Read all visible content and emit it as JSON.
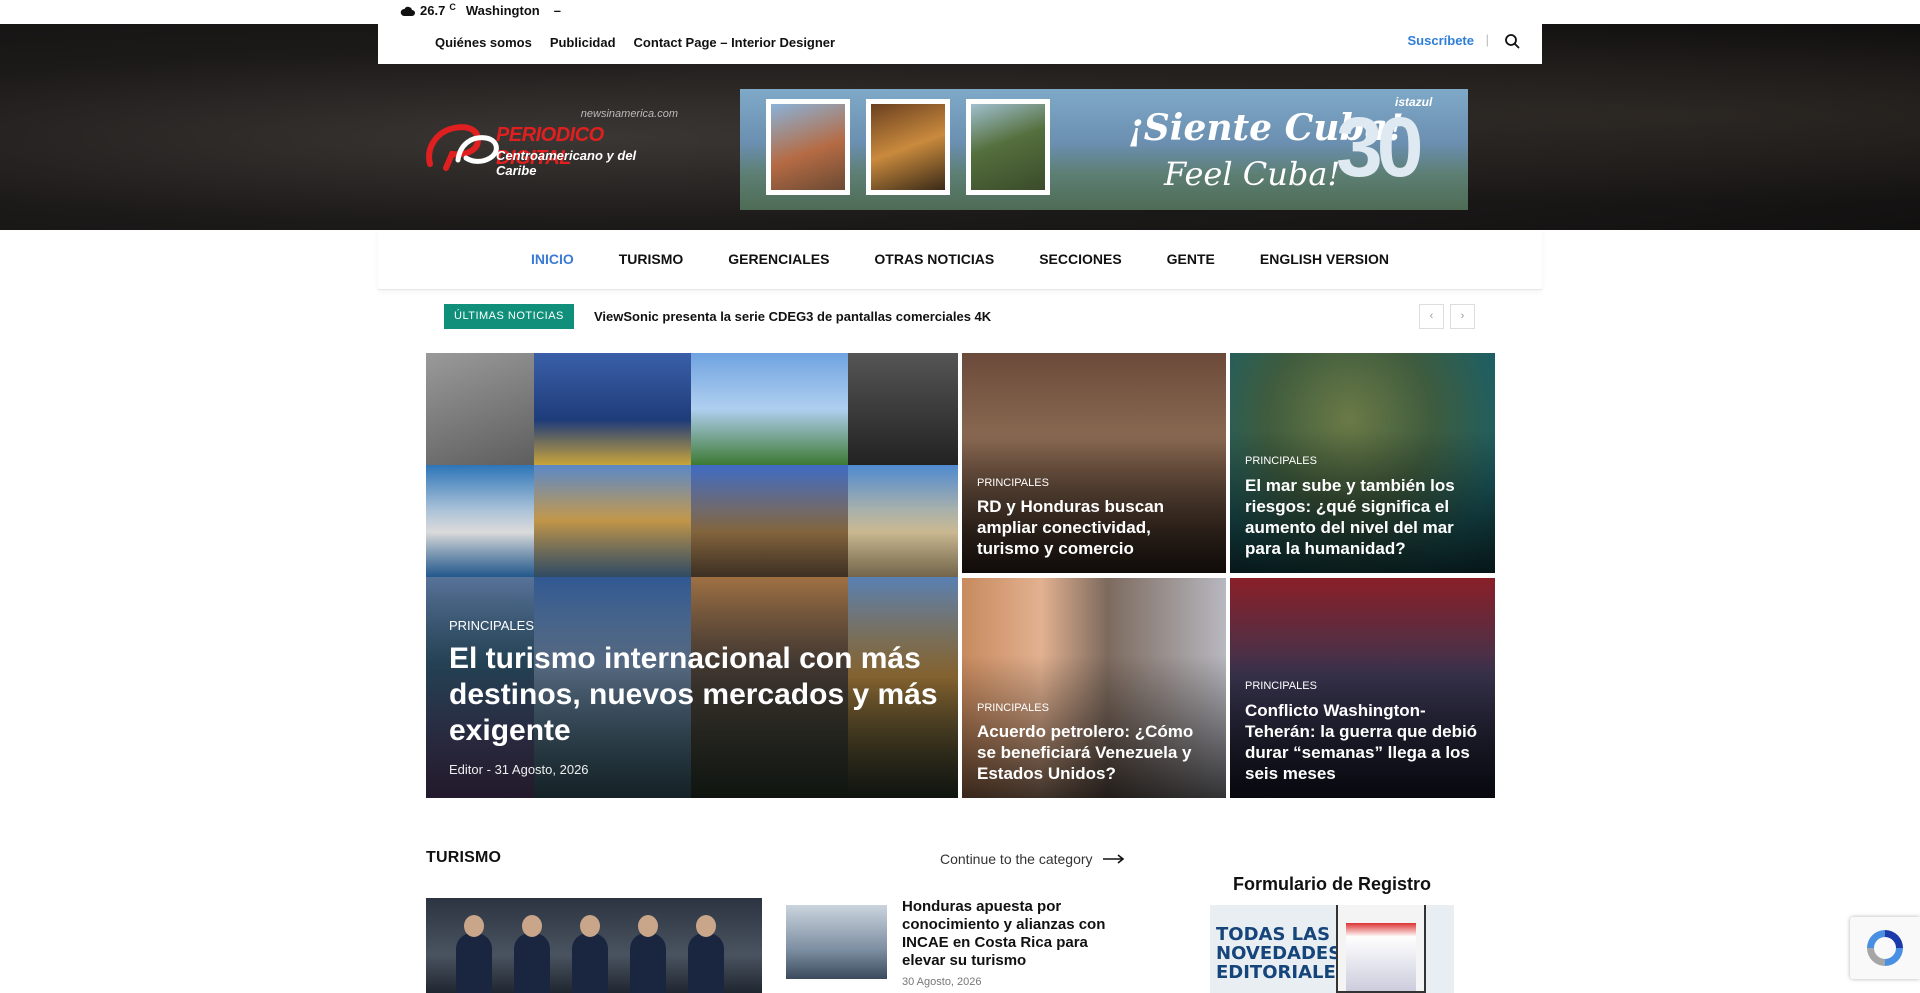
{
  "topbar": {
    "temperature": "26.7",
    "unit": "C",
    "city": "Washington",
    "dash": "–"
  },
  "secondary_nav": {
    "links": [
      "Quiénes somos",
      "Publicidad",
      "Contact Page – Interior Designer"
    ],
    "subscribe": "Suscríbete",
    "separator": "|"
  },
  "logo": {
    "site": "newsinamerica.com",
    "name": "PERIODICO DIGITAL",
    "tagline": "Centroamericano y del Caribe"
  },
  "banner": {
    "line1": "¡Siente Cuba!",
    "line2": "Feel Cuba!",
    "number": "30",
    "brand": "istazul"
  },
  "main_nav": {
    "items": [
      "INICIO",
      "TURISMO",
      "GERENCIALES",
      "OTRAS NOTICIAS",
      "SECCIONES",
      "GENTE",
      "ENGLISH VERSION"
    ],
    "active": "INICIO"
  },
  "ticker": {
    "label": "ÚLTIMAS NOTICIAS",
    "headline": "ViewSonic presenta la serie CDEG3 de pantallas comerciales 4K",
    "prev": "‹",
    "next": "›"
  },
  "featured": {
    "big": {
      "category": "PRINCIPALES",
      "title": "El turismo internacional con más destinos, nuevos mercados y más exigente",
      "author": "Editor",
      "sep": "-",
      "date": "31 Agosto, 2026"
    },
    "items": [
      {
        "category": "PRINCIPALES",
        "title": "RD y Honduras buscan ampliar conectividad, turismo y comercio"
      },
      {
        "category": "PRINCIPALES",
        "title": "El mar sube y también los riesgos: ¿qué significa el aumento del nivel del mar para la humanidad?"
      },
      {
        "category": "PRINCIPALES",
        "title": "Acuerdo petrolero: ¿Cómo se beneficiará Venezuela y Estados Unidos?"
      },
      {
        "category": "PRINCIPALES",
        "title": "Conflicto Washington-Teherán: la guerra que debió durar “semanas” llega a los seis meses"
      }
    ]
  },
  "turismo": {
    "heading": "TURISMO",
    "more": "Continue to the category",
    "article_title": "Honduras apuesta por conocimiento y alianzas con INCAE en Costa Rica para elevar su turismo",
    "article_date": "30 Agosto, 2026"
  },
  "sidebar": {
    "form_title": "Formulario de Registro",
    "promo_lines": [
      "TODAS LAS",
      "NOVEDADES",
      "EDITORIALES"
    ]
  },
  "colors": {
    "accent": "#3a7bd5",
    "subscribe": "#2e7ed8",
    "ticker_tag": "#10907a",
    "logo_red": "#e02020"
  },
  "icons": {
    "weather": "cloud-icon",
    "search": "search-icon",
    "arrow": "long-arrow-right-icon",
    "recaptcha": "recaptcha-icon"
  }
}
